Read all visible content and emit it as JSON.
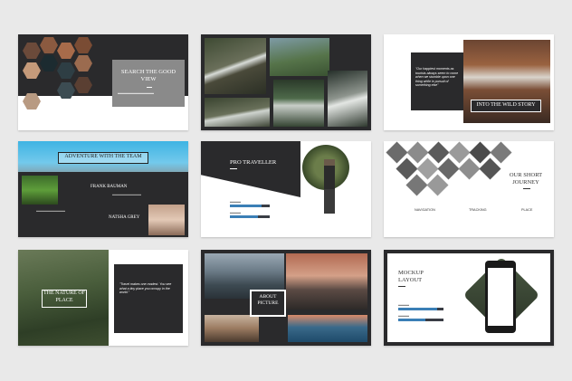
{
  "slides": [
    {
      "title": "SEARCH THE GOOD VIEW"
    },
    {
      "title": ""
    },
    {
      "title": "INTO THE WILD STORY",
      "quote": "\"Our happiest moments as tourists always seem to come when we stumble upon one thing while in pursuit of something else\""
    },
    {
      "title": "ADVENTURE WITH THE TEAM",
      "person1": "FRANK BAUMAN",
      "person2": "NATSHA GREY"
    },
    {
      "title": "PRO TRAVELLER"
    },
    {
      "title": "OUR SHORT JOURNEY",
      "labels": [
        "NAVIGATION",
        "TRACKING",
        "PLACE"
      ]
    },
    {
      "title": "THE NATURE OF PLACE",
      "quote": "\"Travel makes one modest. You see what a tiny place you occupy in the world.\""
    },
    {
      "title": "ABOUT PICTURE"
    },
    {
      "title": "MOCKUP LAYOUT"
    }
  ],
  "colors": {
    "background": "#e9e9e9",
    "dark": "#2a2a2c",
    "accent": "#3b7fb6",
    "overlay": "#8a8a8a"
  },
  "progress": {
    "pro_traveller": [
      0.8,
      0.7
    ],
    "mockup_layout": [
      0.85,
      0.6
    ]
  }
}
